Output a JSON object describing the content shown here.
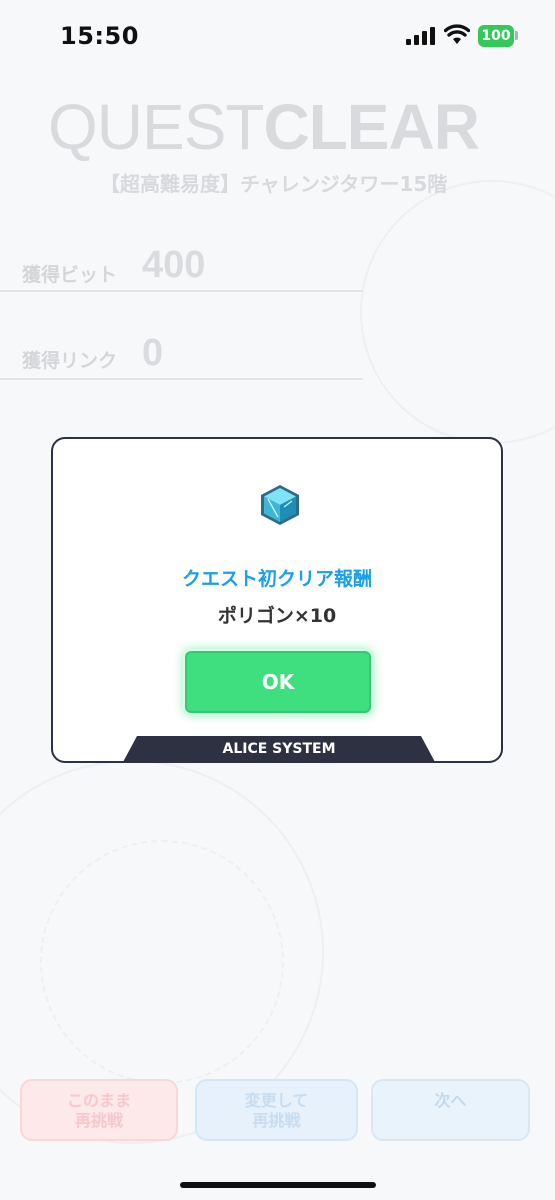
{
  "status_bar": {
    "time": "15:50",
    "battery": "100",
    "icons": [
      "signal-icon",
      "wifi-icon",
      "battery-icon"
    ]
  },
  "background": {
    "title_part1": "QUEST",
    "title_part2": "CLEAR",
    "subtitle": "【超高難易度】チャレンジタワー15階",
    "stats": [
      {
        "label": "獲得ビット",
        "value": "400"
      },
      {
        "label": "獲得リンク",
        "value": "0"
      }
    ],
    "buttons": {
      "retry_same": [
        "このまま",
        "再挑戦"
      ],
      "retry_change": [
        "変更して",
        "再挑戦"
      ],
      "next": "次へ"
    }
  },
  "dialog": {
    "icon": "polygon-cube-icon",
    "title": "クエスト初クリア報酬",
    "reward": "ポリゴン×10",
    "ok_label": "OK",
    "footer": "ALICE SYSTEM"
  },
  "colors": {
    "ok_button": "#3fde7f",
    "dialog_title": "#1aa0e8",
    "dialog_border": "#2d3142",
    "battery": "#34c759"
  }
}
